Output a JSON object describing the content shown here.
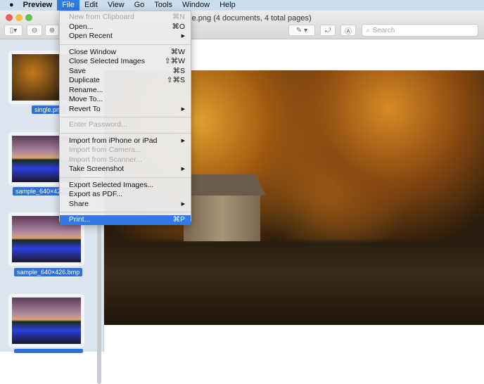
{
  "menubar": {
    "app": "Preview",
    "items": [
      "File",
      "Edit",
      "View",
      "Go",
      "Tools",
      "Window",
      "Help"
    ]
  },
  "window": {
    "title": "single.png (4 documents, 4 total pages)",
    "search_placeholder": "Search"
  },
  "sidebar": {
    "thumbnails": [
      {
        "label": "single.png"
      },
      {
        "label": "sample_640×426.bmp"
      },
      {
        "label": "sample_640×426.bmp"
      },
      {
        "label": ""
      }
    ]
  },
  "file_menu": {
    "groups": [
      [
        {
          "label": "New from Clipboard",
          "shortcut": "⌘N",
          "disabled": true
        },
        {
          "label": "Open...",
          "shortcut": "⌘O"
        },
        {
          "label": "Open Recent",
          "shortcut": "▶"
        }
      ],
      [
        {
          "label": "Close Window",
          "shortcut": "⌘W"
        },
        {
          "label": "Close Selected Images",
          "shortcut": "⇧⌘W"
        },
        {
          "label": "Save",
          "shortcut": "⌘S"
        },
        {
          "label": "Duplicate",
          "shortcut": "⇧⌘S"
        },
        {
          "label": "Rename...",
          "shortcut": ""
        },
        {
          "label": "Move To...",
          "shortcut": ""
        },
        {
          "label": "Revert To",
          "shortcut": "▶"
        }
      ],
      [
        {
          "label": "Enter Password...",
          "shortcut": "",
          "disabled": true
        }
      ],
      [
        {
          "label": "Import from iPhone or iPad",
          "shortcut": "▶"
        },
        {
          "label": "Import from Camera...",
          "shortcut": "",
          "disabled": true
        },
        {
          "label": "Import from Scanner...",
          "shortcut": "",
          "disabled": true
        },
        {
          "label": "Take Screenshot",
          "shortcut": "▶"
        }
      ],
      [
        {
          "label": "Export Selected Images...",
          "shortcut": ""
        },
        {
          "label": "Export as PDF...",
          "shortcut": ""
        },
        {
          "label": "Share",
          "shortcut": "▶"
        }
      ],
      [
        {
          "label": "Print...",
          "shortcut": "⌘P",
          "selected": true
        }
      ]
    ]
  }
}
